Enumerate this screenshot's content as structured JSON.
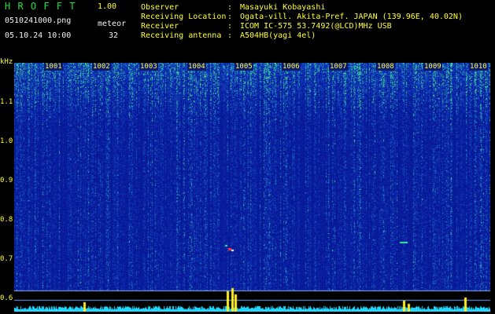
{
  "header": {
    "app_name": "H R O F F T",
    "version": "1.00",
    "filename": "0510241000.png",
    "datetime": "05.10.24 10:00",
    "meteor_label": "meteor",
    "meteor_count": "32"
  },
  "info": [
    {
      "label": "Observer",
      "value": "Masayuki Kobayashi"
    },
    {
      "label": "Receiving Location",
      "value": "Ogata-vill. Akita-Pref. JAPAN (139.96E, 40.02N)"
    },
    {
      "label": "Receiver",
      "value": "ICOM IC-575 53.7492(@LCD)MHz USB"
    },
    {
      "label": "Receiving antenna",
      "value": "A504HB(yagi 4el)"
    }
  ],
  "y_axis": {
    "unit": "kHz",
    "ticks": [
      "1.1",
      "1.0",
      "0.9",
      "0.8",
      "0.7",
      "0.6"
    ]
  },
  "x_axis": {
    "minute_ticks": [
      "1001",
      "1002",
      "1003",
      "1004",
      "1005",
      "1006",
      "1007",
      "1008",
      "1009",
      "1010"
    ]
  },
  "colors": {
    "background": "#000000",
    "header_green": "#22e03a",
    "header_yellow": "#ffff33",
    "spectrogram_base": "#0b1fa0",
    "noise_green": "#3cd28a",
    "echo_red": "#ff3030",
    "baseline_cyan": "#22d8ff",
    "meteor_yellow": "#ffee22"
  }
}
